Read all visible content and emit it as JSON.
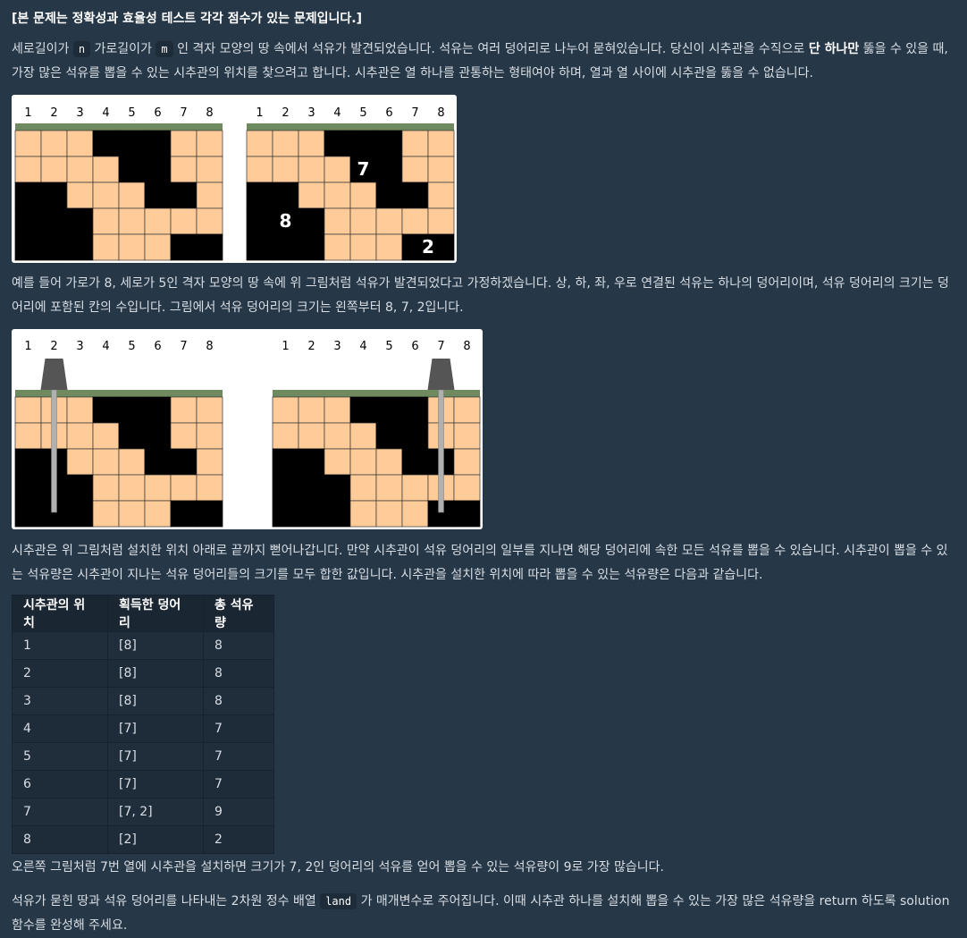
{
  "notice": "[본 문제는 정확성과 효율성 테스트 각각 점수가 있는 문제입니다.]",
  "intro": {
    "part1": "세로길이가",
    "n_code": "n",
    "part2": "가로길이가",
    "m_code": "m",
    "part3": "인 격자 모양의 땅 속에서 석유가 발견되었습니다. 석유는 여러 덩어리로 나누어 묻혀있습니다. 당신이 시추관을 수직으로",
    "bold": "단 하나만",
    "part4": "뚫을 수 있을 때, 가장 많은 석유를 뽑을 수 있는 시추관의 위치를 찾으려고 합니다. 시추관은 열 하나를 관통하는 형태여야 하며, 열과 열 사이에 시추관을 뚫을 수 없습니다."
  },
  "example_text": "예를 들어 가로가 8, 세로가 5인 격자 모양의 땅 속에 위 그림처럼 석유가 발견되었다고 가정하겠습니다. 상, 하, 좌, 우로 연결된 석유는 하나의 덩어리이며, 석유 덩어리의 크기는 덩어리에 포함된 칸의 수입니다. 그림에서 석유 덩어리의 크기는 왼쪽부터 8, 7, 2입니다.",
  "drill_text": "시추관은 위 그림처럼 설치한 위치 아래로 끝까지 뻗어나갑니다. 만약 시추관이 석유 덩어리의 일부를 지나면 해당 덩어리에 속한 모든 석유를 뽑을 수 있습니다. 시추관이 뽑을 수 있는 석유량은 시추관이 지나는 석유 덩어리들의 크기를 모두 합한 값입니다. 시추관을 설치한 위치에 따라 뽑을 수 있는 석유량은 다음과 같습니다.",
  "figure": {
    "column_numbers": [
      "1",
      "2",
      "3",
      "4",
      "5",
      "6",
      "7",
      "8"
    ],
    "grid": [
      [
        0,
        0,
        0,
        1,
        1,
        1,
        0,
        0
      ],
      [
        0,
        0,
        0,
        0,
        1,
        1,
        0,
        0
      ],
      [
        1,
        1,
        0,
        0,
        0,
        1,
        1,
        0
      ],
      [
        1,
        1,
        1,
        0,
        0,
        0,
        0,
        0
      ],
      [
        1,
        1,
        1,
        0,
        0,
        0,
        1,
        1
      ]
    ],
    "chunk_labels": [
      "7",
      "8",
      "2"
    ],
    "drill_columns": [
      2,
      7
    ]
  },
  "table": {
    "headers": [
      "시추관의 위치",
      "획득한 덩어리",
      "총 석유량"
    ],
    "rows": [
      [
        "1",
        "[8]",
        "8"
      ],
      [
        "2",
        "[8]",
        "8"
      ],
      [
        "3",
        "[8]",
        "8"
      ],
      [
        "4",
        "[7]",
        "7"
      ],
      [
        "5",
        "[7]",
        "7"
      ],
      [
        "6",
        "[7]",
        "7"
      ],
      [
        "7",
        "[7, 2]",
        "9"
      ],
      [
        "8",
        "[2]",
        "2"
      ]
    ]
  },
  "conclusion": "오른쪽 그림처럼 7번 열에 시추관을 설치하면 크기가 7, 2인 덩어리의 석유를 얻어 뽑을 수 있는 석유량이 9로 가장 많습니다.",
  "param": {
    "part1": "석유가 묻힌 땅과 석유 덩어리를 나타내는 2차원 정수 배열",
    "code": "land",
    "part2": "가 매개변수로 주어집니다. 이때 시추관 하나를 설치해 뽑을 수 있는 가장 많은 석유량을 return 하도록 solution 함수를 완성해 주세요."
  },
  "colors": {
    "background": "#263747",
    "oil": "#000000",
    "ground": "#ffcc99",
    "surface": "#6e8a5e",
    "pipe": "#b0b0b0",
    "drill_head": "#555555"
  }
}
